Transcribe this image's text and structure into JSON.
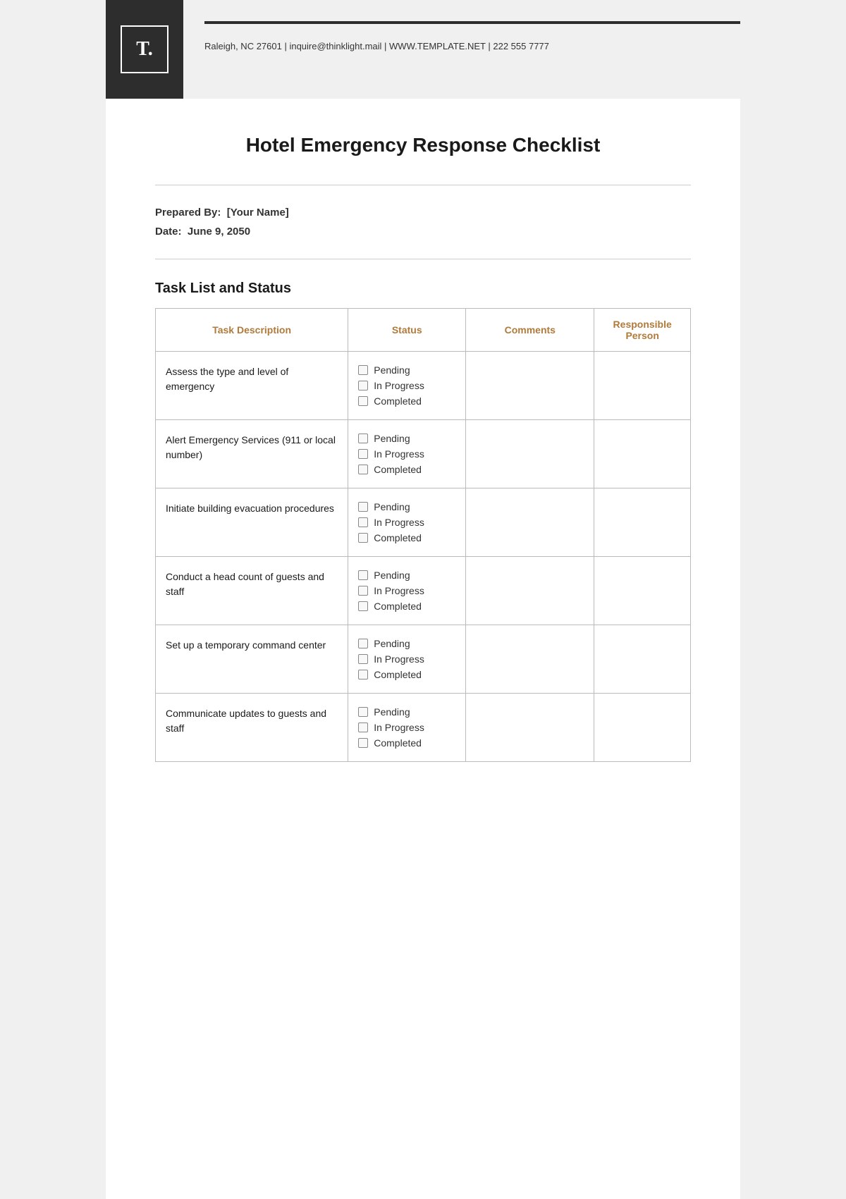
{
  "header": {
    "logo_letter": "T.",
    "contact": "Raleigh, NC 27601 | inquire@thinklight.mail | WWW.TEMPLATE.NET | 222 555 7777"
  },
  "document": {
    "title": "Hotel Emergency Response Checklist",
    "prepared_by_label": "Prepared By:",
    "prepared_by_value": "[Your Name]",
    "date_label": "Date:",
    "date_value": "June 9, 2050"
  },
  "table": {
    "section_title": "Task List and Status",
    "columns": [
      "Task Description",
      "Status",
      "Comments",
      "Responsible\nPerson"
    ],
    "status_options": [
      "Pending",
      "In Progress",
      "Completed"
    ],
    "rows": [
      {
        "task": "Assess the type and level of emergency",
        "comments": "",
        "person": ""
      },
      {
        "task": "Alert Emergency Services (911 or local number)",
        "comments": "",
        "person": ""
      },
      {
        "task": "Initiate building evacuation procedures",
        "comments": "",
        "person": ""
      },
      {
        "task": "Conduct a head count of guests and staff",
        "comments": "",
        "person": ""
      },
      {
        "task": "Set up a temporary command center",
        "comments": "",
        "person": ""
      },
      {
        "task": "Communicate updates to guests and staff",
        "comments": "",
        "person": ""
      }
    ]
  }
}
